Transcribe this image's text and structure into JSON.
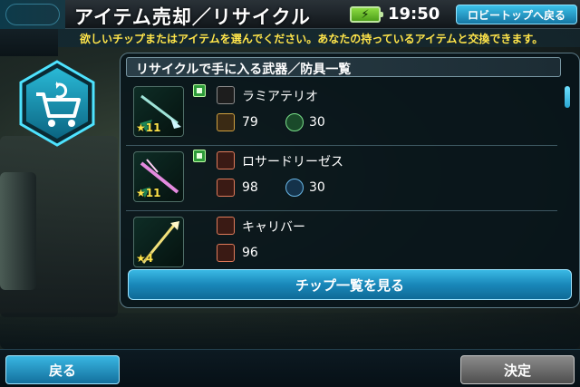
{
  "header": {
    "title": "アイテム売却／リサイクル",
    "clock": "19:50",
    "battery_icon": "battery-charging-icon",
    "lobby_button": "ロビートップへ戻る"
  },
  "instruction": "欲しいチップまたはアイテムを選んでください。あなたの持っているアイテムと交換できます。",
  "panel": {
    "title": "リサイクルで手に入る武器／防具一覧",
    "items": [
      {
        "name": "ラミアテリオ",
        "rarity": "★11",
        "category_icon": "wand-icon",
        "cost_icon": "key-icon",
        "cost_value": "79",
        "resource_icon": "wind-icon",
        "resource_value": "30"
      },
      {
        "name": "ロサードリーゼス",
        "rarity": "★11",
        "category_icon": "sword-icon",
        "cost_icon": "sword-icon",
        "cost_value": "98",
        "resource_icon": "gear-icon",
        "resource_value": "30"
      },
      {
        "name": "キャリバー",
        "rarity": "★4",
        "category_icon": "sword-icon",
        "cost_icon": "sword-icon",
        "cost_value": "96"
      }
    ],
    "chip_list_button": "チップ一覧を見る"
  },
  "footer": {
    "back_button": "戻る",
    "confirm_button": "決定"
  },
  "colors": {
    "accent_blue": "#1987b9",
    "instruction_yellow": "#ffe54a",
    "battery_green": "#8cdc42"
  }
}
